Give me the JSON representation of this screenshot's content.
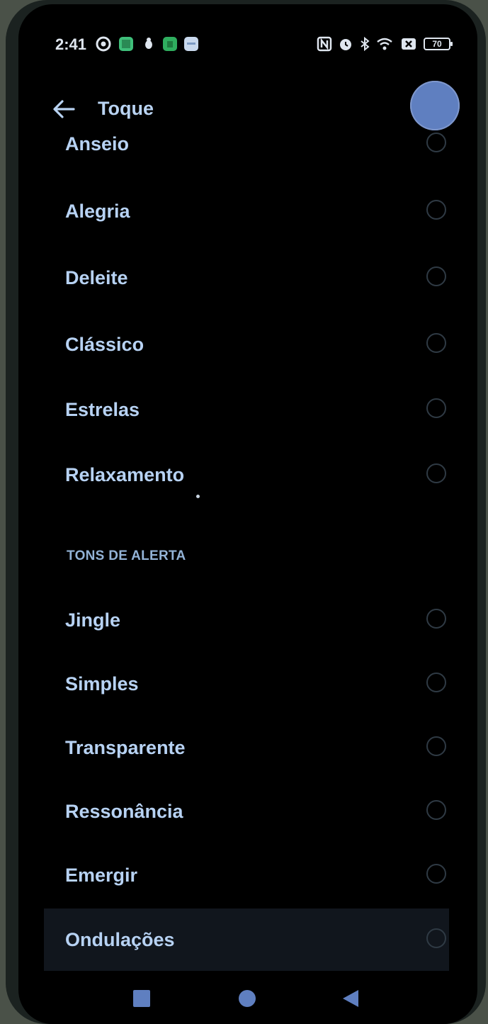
{
  "status_bar": {
    "time": "2:41",
    "battery": "70"
  },
  "app_bar": {
    "title": "Toque"
  },
  "ringtones": [
    {
      "label": "Anseio",
      "selected": false
    },
    {
      "label": "Alegria",
      "selected": false
    },
    {
      "label": "Deleite",
      "selected": false
    },
    {
      "label": "Clássico",
      "selected": false
    },
    {
      "label": "Estrelas",
      "selected": false
    },
    {
      "label": "Relaxamento",
      "selected": false
    }
  ],
  "alert_section": {
    "header": "TONS DE ALERTA",
    "items": [
      {
        "label": "Jingle",
        "selected": false
      },
      {
        "label": "Simples",
        "selected": false
      },
      {
        "label": "Transparente",
        "selected": false
      },
      {
        "label": "Ressonância",
        "selected": false
      },
      {
        "label": "Emergir",
        "selected": false
      },
      {
        "label": "Ondulações",
        "selected": false
      }
    ]
  },
  "colors": {
    "text": "#b7d2f3",
    "accent": "#5f7fc0",
    "background": "#000000"
  },
  "icons": {
    "back": "arrow-left-icon",
    "nav_recent": "square-icon",
    "nav_home": "circle-icon",
    "nav_back": "triangle-icon"
  }
}
